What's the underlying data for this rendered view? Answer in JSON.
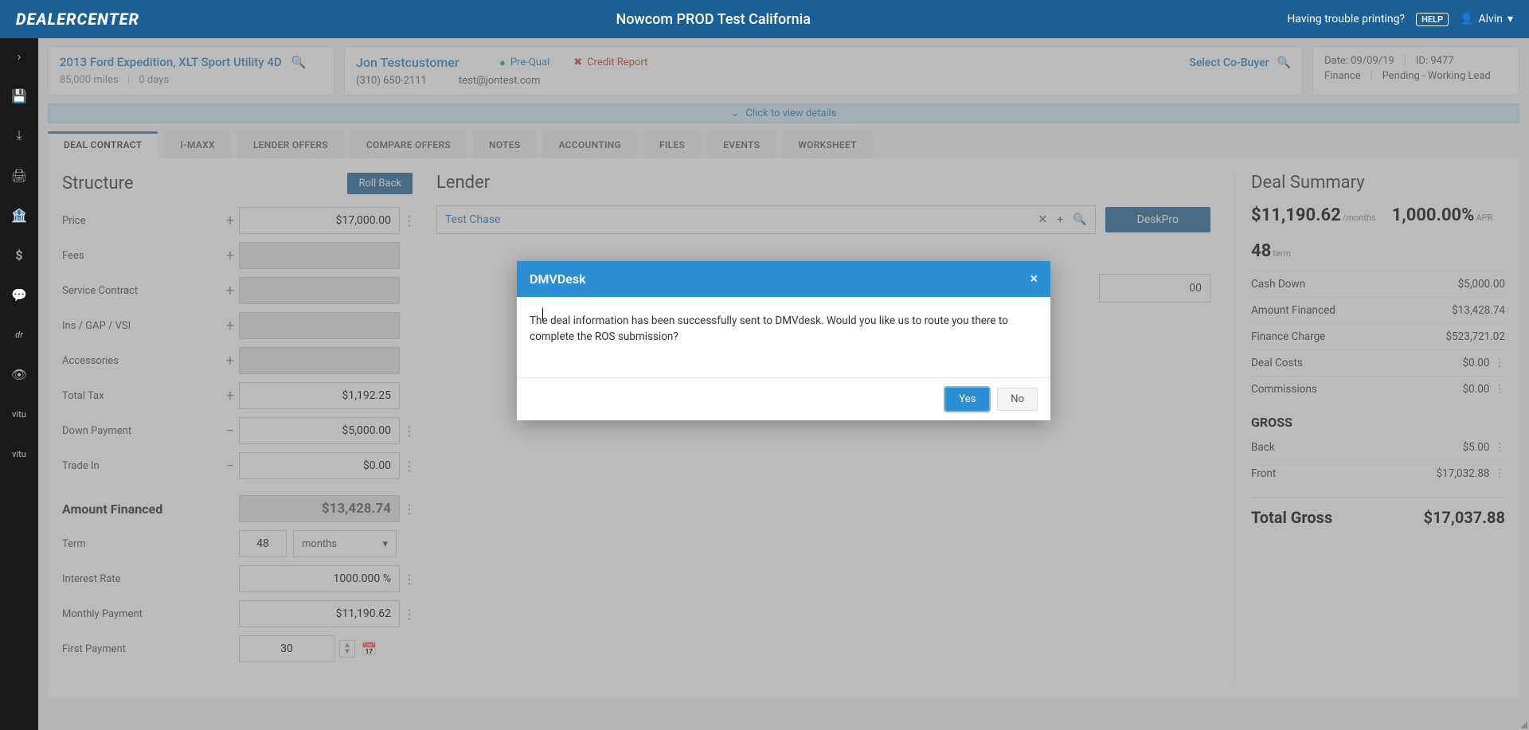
{
  "topbar": {
    "logo": "DEALERCENTER",
    "title": "Nowcom PROD Test California",
    "trouble": "Having trouble printing?",
    "help": "HELP",
    "user": "Alvin"
  },
  "leftrail": {
    "vitu1": "vitu",
    "vitu2": "vitu"
  },
  "header": {
    "vehicle_title": "2013 Ford Expedition, XLT Sport Utility 4D",
    "vehicle_miles": "85,000 miles",
    "vehicle_days": "0 days",
    "customer_name": "Jon Testcustomer",
    "customer_phone": "(310) 650-2111",
    "customer_email": "test@jontest.com",
    "prequal": "Pre-Qual",
    "credit": "Credit Report",
    "cobuyer": "Select Co-Buyer",
    "date_label": "Date: 09/09/19",
    "id_label": "ID: 9477",
    "finance": "Finance",
    "status": "Pending - Working Lead",
    "clickbar": "Click to view details"
  },
  "tabs": [
    "DEAL CONTRACT",
    "I-MAXX",
    "LENDER OFFERS",
    "COMPARE OFFERS",
    "NOTES",
    "ACCOUNTING",
    "FILES",
    "EVENTS",
    "WORKSHEET"
  ],
  "structure": {
    "heading": "Structure",
    "rollback": "Roll Back",
    "rows": {
      "price": {
        "label": "Price",
        "value": "$17,000.00"
      },
      "fees": {
        "label": "Fees",
        "value": ""
      },
      "service": {
        "label": "Service Contract",
        "value": ""
      },
      "ins": {
        "label": "Ins / GAP / VSI",
        "value": ""
      },
      "acc": {
        "label": "Accessories",
        "value": ""
      },
      "tax": {
        "label": "Total Tax",
        "value": "$1,192.25"
      },
      "down": {
        "label": "Down Payment",
        "value": "$5,000.00"
      },
      "trade": {
        "label": "Trade In",
        "value": "$0.00"
      },
      "af": {
        "label": "Amount Financed",
        "value": "$13,428.74"
      },
      "term": {
        "label": "Term",
        "value": "48",
        "unit": "months"
      },
      "rate": {
        "label": "Interest Rate",
        "value": "1000.000 %"
      },
      "monthly": {
        "label": "Monthly Payment",
        "value": "$11,190.62"
      },
      "first": {
        "label": "First Payment",
        "value": "30"
      }
    }
  },
  "lender": {
    "heading": "Lender",
    "name": "Test Chase",
    "deskpro": "DeskPro",
    "amount": "00"
  },
  "summary": {
    "heading": "Deal Summary",
    "payment": "$11,190.62",
    "payment_unit": "/months",
    "apr": "1,000.00%",
    "apr_unit": "APR",
    "term": "48",
    "term_unit": "term",
    "cashdown": {
      "label": "Cash Down",
      "value": "$5,000.00"
    },
    "af": {
      "label": "Amount Financed",
      "value": "$13,428.74"
    },
    "fc": {
      "label": "Finance Charge",
      "value": "$523,721.02"
    },
    "costs": {
      "label": "Deal Costs",
      "value": "$0.00"
    },
    "comm": {
      "label": "Commissions",
      "value": "$0.00"
    },
    "gross": "GROSS",
    "back": {
      "label": "Back",
      "value": "$5.00"
    },
    "front": {
      "label": "Front",
      "value": "$17,032.88"
    },
    "total": {
      "label": "Total Gross",
      "value": "$17,037.88"
    }
  },
  "modal": {
    "title": "DMVDesk",
    "body": "The deal information has been successfully sent to DMVdesk. Would you like us to route you there to complete the ROS submission?",
    "yes": "Yes",
    "no": "No"
  }
}
